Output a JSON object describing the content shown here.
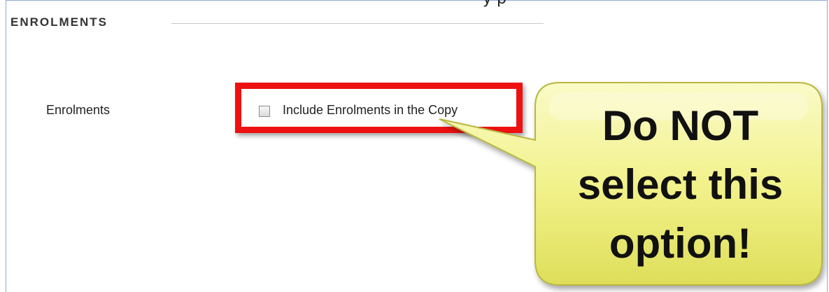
{
  "section": {
    "title": "ENROLMENTS"
  },
  "top_fragment": "y     p",
  "form": {
    "field_label": "Enrolments",
    "checkbox_label": "Include Enrolments in the Copy",
    "checkbox_checked": false
  },
  "callout": {
    "lines": [
      "Do NOT",
      "select this",
      "option!"
    ],
    "fill_color": "#f2f28c",
    "highlight_color": "#ee1111"
  }
}
